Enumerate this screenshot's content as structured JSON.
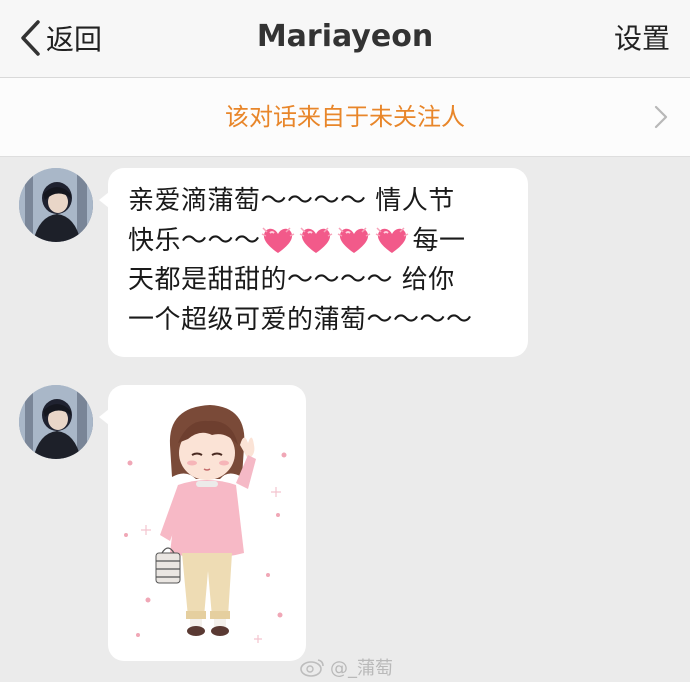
{
  "nav": {
    "back_label": "返回",
    "title": "Mariayeon",
    "settings_label": "设置"
  },
  "notice": {
    "text": "该对话来自于未关注人"
  },
  "messages": [
    {
      "type": "text",
      "line1": "亲爱滴蒲萄～～～～ 情人节",
      "line2a": "快乐～～～",
      "line2b": "每一",
      "line3": "天都是甜甜的～～～～ 给你",
      "line4": "一个超级可爱的蒲萄～～～～",
      "heart_count": 4
    },
    {
      "type": "sticker",
      "sticker": "girl-sticker"
    }
  ],
  "watermark": {
    "text": "@_蒲萄"
  },
  "colors": {
    "accent": "#e8862a",
    "background": "#ebebeb",
    "bubble": "#ffffff"
  }
}
